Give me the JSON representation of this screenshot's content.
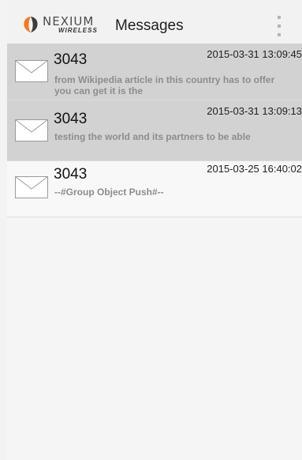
{
  "app": {
    "logo_word": "NEXIUM",
    "logo_sub": "WIRELESS",
    "title": "Messages",
    "overflow_icon": "more-vert-icon"
  },
  "colors": {
    "read_row_bg": "#d2d2d2",
    "unread_row_bg": "#f8f8f8",
    "logo_orange": "#f47920",
    "logo_dark": "#3c3c3c"
  },
  "messages": [
    {
      "sender": "3043",
      "timestamp": "2015-03-31 13:09:45",
      "preview": "from Wikipedia article in this country has to offer you can get it is the",
      "state": "read",
      "icon": "envelope-icon"
    },
    {
      "sender": "3043",
      "timestamp": "2015-03-31 13:09:13",
      "preview": "testing the world and its partners to be able",
      "state": "read",
      "icon": "envelope-icon"
    },
    {
      "sender": "3043",
      "timestamp": "2015-03-25 16:40:02",
      "preview": "--#Group Object Push#--",
      "state": "unread",
      "icon": "envelope-icon"
    }
  ]
}
